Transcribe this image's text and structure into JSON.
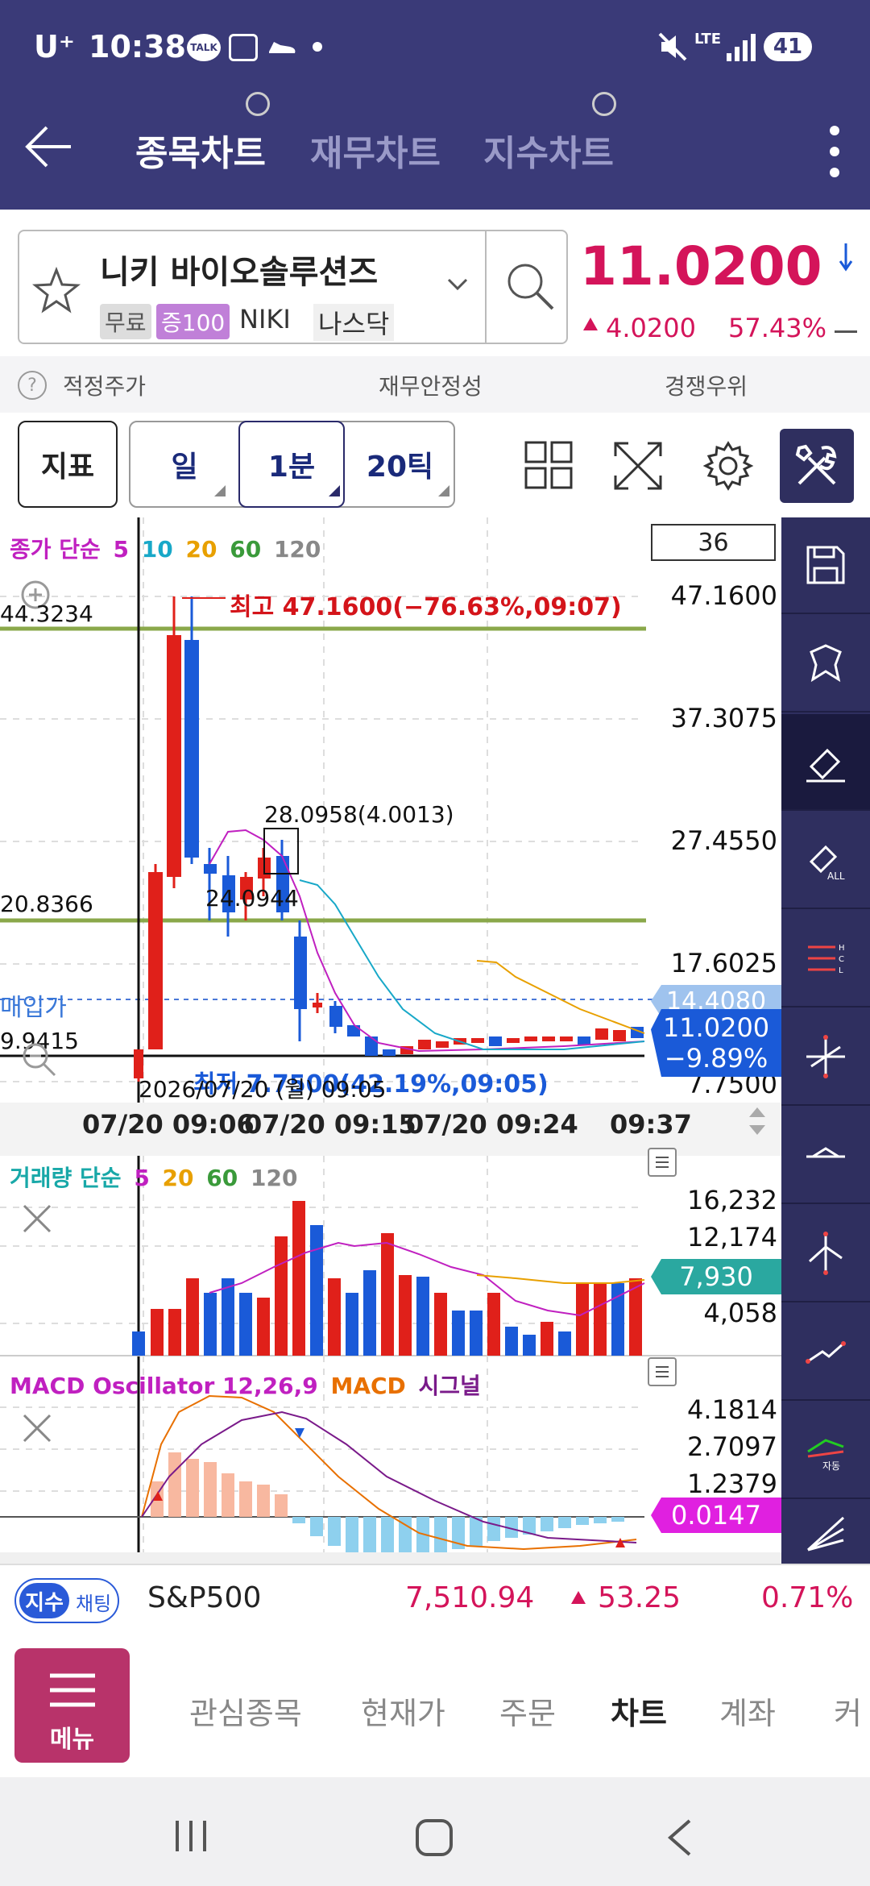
{
  "status": {
    "carrier": "U⁺",
    "time": "10:38",
    "talk": "TALK",
    "net": "LTE",
    "battery": "41"
  },
  "tabs": [
    {
      "label": "종목차트",
      "active": true
    },
    {
      "label": "재무차트",
      "active": false
    },
    {
      "label": "지수차트",
      "active": false
    }
  ],
  "stock": {
    "name": "니키 바이오솔루션즈",
    "tags": [
      "무료",
      "증100"
    ],
    "ticker": "NIKI",
    "market": "나스닥",
    "price": "11.0200",
    "change": "4.0200",
    "change_pct": "57.43%",
    "up_color": "#d4145a"
  },
  "indicators_row": [
    "적정주가",
    "재무안정성",
    "경쟁우위"
  ],
  "controls": {
    "indicator": "지표",
    "period_day": "일",
    "period_min": "1분",
    "period_tick": "20틱"
  },
  "main_chart": {
    "legend": {
      "label": "종가 단순",
      "ma": [
        "5",
        "10",
        "20",
        "60",
        "120"
      ]
    },
    "count_box": "36",
    "y_ticks": [
      "47.1600",
      "37.3075",
      "27.4550",
      "17.6025",
      "7.7500"
    ],
    "left_ticks": [
      "44.3234",
      "20.8366",
      "9.9415"
    ],
    "high_note": "최고 47.1600(−76.63%,09:07)",
    "low_note": "최저 7.7500(42.19%,09:05)",
    "crosshair_date": "2026/07/20 (월) 09:05",
    "annot_1": "28.0958(4.0013)",
    "annot_2": "24.0944",
    "buy_price_label": "매입가",
    "buy_price": "14.4080",
    "current_price": "11.0200",
    "current_change": "−9.89%",
    "x_ticks": [
      "07/20 09:06",
      "07/20 09:15",
      "07/20 09:24",
      "09:37"
    ]
  },
  "volume_chart": {
    "legend": {
      "label": "거래량 단순",
      "ma": [
        "5",
        "20",
        "60",
        "120"
      ]
    },
    "y_ticks": [
      "16,232",
      "12,174",
      "4,058"
    ],
    "current": "7,930"
  },
  "macd_chart": {
    "legend": {
      "label": "MACD Oscillator 12,26,9",
      "macd": "MACD",
      "signal": "시그널"
    },
    "y_ticks": [
      "4.1814",
      "2.7097",
      "1.2379"
    ],
    "current": "0.0147"
  },
  "ticker_bar": {
    "tag1": "지수",
    "tag2": "채팅",
    "name": "S&P500",
    "value": "7,510.94",
    "change": "53.25",
    "pct": "0.71%"
  },
  "menu": {
    "button": "메뉴",
    "items": [
      "관심종목",
      "현재가",
      "주문",
      "차트",
      "계좌",
      "커"
    ],
    "active": "차트"
  }
}
